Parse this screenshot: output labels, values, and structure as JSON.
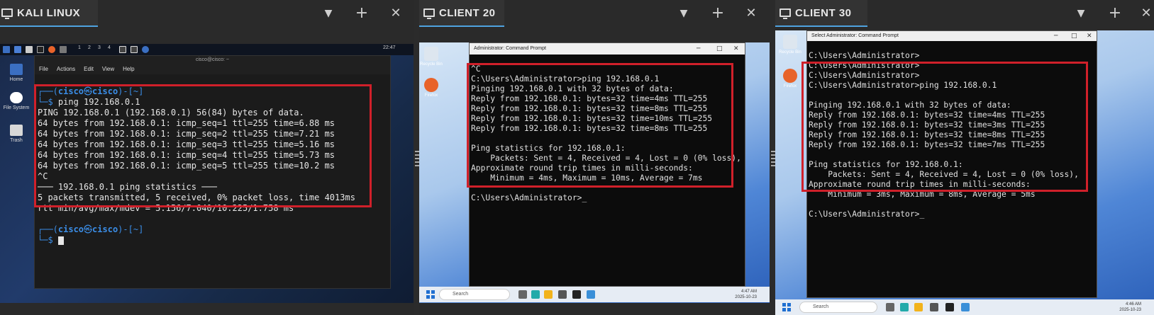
{
  "panes": [
    {
      "title": "KALI LINUX"
    },
    {
      "title": "CLIENT 20"
    },
    {
      "title": "CLIENT 30"
    }
  ],
  "header_buttons": {
    "dropdown": "▼",
    "add": "+",
    "close": "✕"
  },
  "kali": {
    "topbar": {
      "workspaces": [
        "1",
        "2",
        "3",
        "4"
      ],
      "clock": "22:47"
    },
    "window_title": "cisco@cisco: ~",
    "menu": [
      "File",
      "Actions",
      "Edit",
      "View",
      "Help"
    ],
    "desktop_icons": [
      "Home",
      "File System",
      "Trash"
    ],
    "prompt_top": "┌──(",
    "user": "cisco",
    "at": "㉿",
    "host": "cisco",
    "path_part": ")-[~]",
    "prompt_bottom": "└─",
    "dollar": "$ ",
    "command": "ping 192.168.0.1",
    "output": [
      "PING 192.168.0.1 (192.168.0.1) 56(84) bytes of data.",
      "64 bytes from 192.168.0.1: icmp_seq=1 ttl=255 time=6.88 ms",
      "64 bytes from 192.168.0.1: icmp_seq=2 ttl=255 time=7.21 ms",
      "64 bytes from 192.168.0.1: icmp_seq=3 ttl=255 time=5.16 ms",
      "64 bytes from 192.168.0.1: icmp_seq=4 ttl=255 time=5.73 ms",
      "64 bytes from 192.168.0.1: icmp_seq=5 ttl=255 time=10.2 ms",
      "^C",
      "─── 192.168.0.1 ping statistics ───",
      "5 packets transmitted, 5 received, 0% packet loss, time 4013ms",
      "rtt min/avg/max/mdev = 5.156/7.040/10.225/1.758 ms"
    ]
  },
  "client20": {
    "window_title": "Administrator: Command Prompt",
    "lines_before": [
      "^C"
    ],
    "command_line": "C:\\Users\\Administrator>ping 192.168.0.1",
    "output": [
      "",
      "Pinging 192.168.0.1 with 32 bytes of data:",
      "Reply from 192.168.0.1: bytes=32 time=4ms TTL=255",
      "Reply from 192.168.0.1: bytes=32 time=8ms TTL=255",
      "Reply from 192.168.0.1: bytes=32 time=10ms TTL=255",
      "Reply from 192.168.0.1: bytes=32 time=8ms TTL=255",
      "",
      "Ping statistics for 192.168.0.1:",
      "    Packets: Sent = 4, Received = 4, Lost = 0 (0% loss),",
      "Approximate round trip times in milli-seconds:",
      "    Minimum = 4ms, Maximum = 10ms, Average = 7ms"
    ],
    "final_prompt": "C:\\Users\\Administrator>",
    "desktop_icons": [
      "Recycle Bin",
      "Firefox"
    ],
    "taskbar": {
      "search": "Search",
      "time": "4:47 AM",
      "date": "2025-10-23"
    }
  },
  "client30": {
    "window_title": "Select Administrator: Command Prompt",
    "lines_before": [
      "C:\\Users\\Administrator>",
      "C:\\Users\\Administrator>",
      "C:\\Users\\Administrator>"
    ],
    "command_line": "C:\\Users\\Administrator>ping 192.168.0.1",
    "output": [
      "",
      "Pinging 192.168.0.1 with 32 bytes of data:",
      "Reply from 192.168.0.1: bytes=32 time=4ms TTL=255",
      "Reply from 192.168.0.1: bytes=32 time=3ms TTL=255",
      "Reply from 192.168.0.1: bytes=32 time=8ms TTL=255",
      "Reply from 192.168.0.1: bytes=32 time=7ms TTL=255",
      "",
      "Ping statistics for 192.168.0.1:",
      "    Packets: Sent = 4, Received = 4, Lost = 0 (0% loss),",
      "Approximate round trip times in milli-seconds:",
      "    Minimum = 3ms, Maximum = 8ms, Average = 5ms"
    ],
    "final_prompt": "C:\\Users\\Administrator>",
    "desktop_icons": [
      "Recycle Bin",
      "Firefox"
    ],
    "taskbar": {
      "search": "Search",
      "time": "4:46 AM",
      "date": "2025-10-23"
    }
  },
  "colors": {
    "highlight_box": "#d0202a",
    "tab_accent": "#4fa3e0",
    "kali_prompt": "#3b8ee8"
  }
}
